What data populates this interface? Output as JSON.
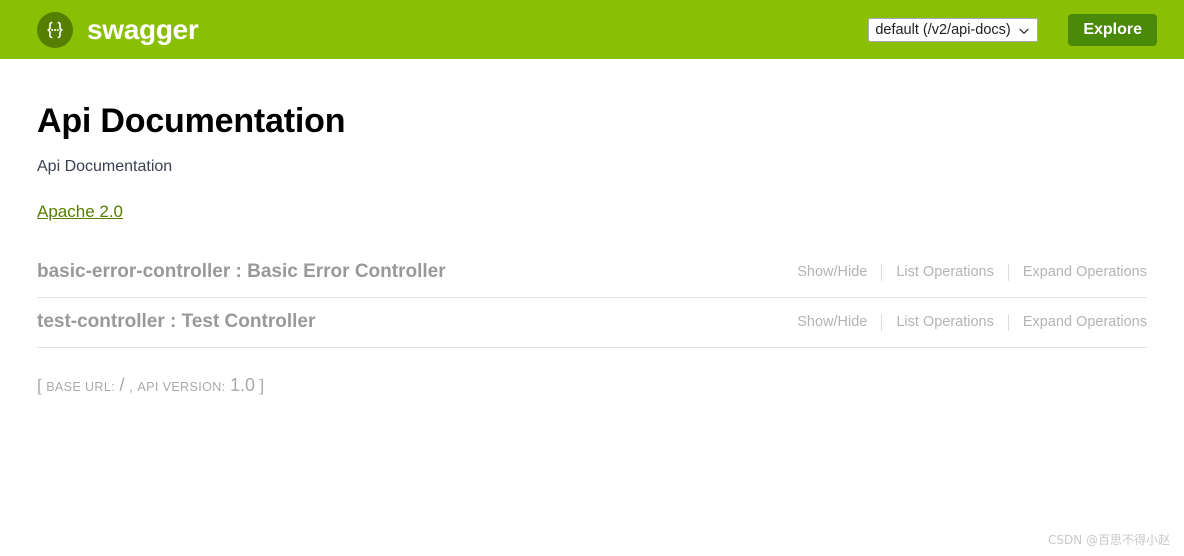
{
  "header": {
    "logo_icon": "swagger-braces-icon",
    "brand_name": "swagger",
    "select": {
      "selected": "default (/v2/api-docs)",
      "options": [
        "default (/v2/api-docs)"
      ],
      "chevron_icon": "chevron-down-icon"
    },
    "explore_label": "Explore",
    "background_color": "#89bf04",
    "logo_color": "#547f00",
    "explore_color": "#4b8a08"
  },
  "main": {
    "title": "Api Documentation",
    "subtitle": "Api Documentation",
    "license_label": "Apache 2.0",
    "license_color": "#547f00"
  },
  "resources": [
    {
      "title": "basic-error-controller : Basic Error Controller",
      "show_hide": "Show/Hide",
      "list_operations": "List Operations",
      "expand_operations": "Expand Operations"
    },
    {
      "title": "test-controller : Test Controller",
      "show_hide": "Show/Hide",
      "list_operations": "List Operations",
      "expand_operations": "Expand Operations"
    }
  ],
  "footer": {
    "open_bracket": "[",
    "base_url_label": "BASE URL:",
    "base_url_value": "/",
    "comma": ",",
    "api_version_label": "API VERSION:",
    "api_version_value": "1.0",
    "close_bracket": "]"
  },
  "watermark": "CSDN @百思不得小赵"
}
